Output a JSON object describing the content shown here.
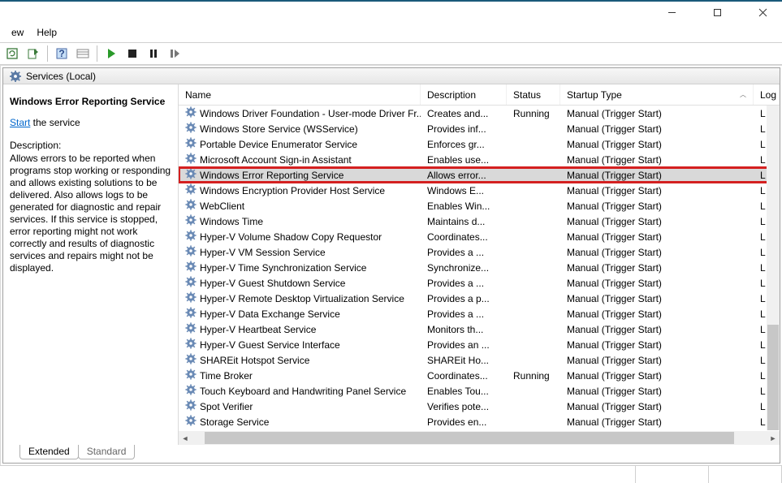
{
  "menus": {
    "view": "ew",
    "help": "Help"
  },
  "frameheader": {
    "title": "Services (Local)"
  },
  "details": {
    "serviceName": "Windows Error Reporting Service",
    "startLink": "Start",
    "startSuffix": " the service",
    "descLabel": "Description:",
    "description": "Allows errors to be reported when programs stop working or responding and allows existing solutions to be delivered. Also allows logs to be generated for diagnostic and repair services. If this service is stopped, error reporting might not work correctly and results of diagnostic services and repairs might not be displayed."
  },
  "columns": {
    "name": "Name",
    "description": "Description",
    "status": "Status",
    "startup": "Startup Type",
    "logon": "Log"
  },
  "services": [
    {
      "name": "Windows Driver Foundation - User-mode Driver Fr...",
      "desc": "Creates and...",
      "status": "Running",
      "startup": "Manual (Trigger Start)",
      "logon": "Loc"
    },
    {
      "name": "Windows Store Service (WSService)",
      "desc": "Provides inf...",
      "status": "",
      "startup": "Manual (Trigger Start)",
      "logon": "Loc"
    },
    {
      "name": "Portable Device Enumerator Service",
      "desc": "Enforces gr...",
      "status": "",
      "startup": "Manual (Trigger Start)",
      "logon": "Loc"
    },
    {
      "name": "Microsoft Account Sign-in Assistant",
      "desc": "Enables use...",
      "status": "",
      "startup": "Manual (Trigger Start)",
      "logon": "Loc"
    },
    {
      "name": "Windows Error Reporting Service",
      "desc": "Allows error...",
      "status": "",
      "startup": "Manual (Trigger Start)",
      "logon": "Loc",
      "highlight": true,
      "selected": true
    },
    {
      "name": "Windows Encryption Provider Host Service",
      "desc": "Windows E...",
      "status": "",
      "startup": "Manual (Trigger Start)",
      "logon": "Loc"
    },
    {
      "name": "WebClient",
      "desc": "Enables Win...",
      "status": "",
      "startup": "Manual (Trigger Start)",
      "logon": "Loc"
    },
    {
      "name": "Windows Time",
      "desc": "Maintains d...",
      "status": "",
      "startup": "Manual (Trigger Start)",
      "logon": "Loc"
    },
    {
      "name": "Hyper-V Volume Shadow Copy Requestor",
      "desc": "Coordinates...",
      "status": "",
      "startup": "Manual (Trigger Start)",
      "logon": "Loc"
    },
    {
      "name": "Hyper-V VM Session Service",
      "desc": "Provides a ...",
      "status": "",
      "startup": "Manual (Trigger Start)",
      "logon": "Loc"
    },
    {
      "name": "Hyper-V Time Synchronization Service",
      "desc": "Synchronize...",
      "status": "",
      "startup": "Manual (Trigger Start)",
      "logon": "Loc"
    },
    {
      "name": "Hyper-V Guest Shutdown Service",
      "desc": "Provides a ...",
      "status": "",
      "startup": "Manual (Trigger Start)",
      "logon": "Loc"
    },
    {
      "name": "Hyper-V Remote Desktop Virtualization Service",
      "desc": "Provides a p...",
      "status": "",
      "startup": "Manual (Trigger Start)",
      "logon": "Loc"
    },
    {
      "name": "Hyper-V Data Exchange Service",
      "desc": "Provides a ...",
      "status": "",
      "startup": "Manual (Trigger Start)",
      "logon": "Loc"
    },
    {
      "name": "Hyper-V Heartbeat Service",
      "desc": "Monitors th...",
      "status": "",
      "startup": "Manual (Trigger Start)",
      "logon": "Loc"
    },
    {
      "name": "Hyper-V Guest Service Interface",
      "desc": "Provides an ...",
      "status": "",
      "startup": "Manual (Trigger Start)",
      "logon": "Loc"
    },
    {
      "name": "SHAREit Hotspot Service",
      "desc": "SHAREit Ho...",
      "status": "",
      "startup": "Manual (Trigger Start)",
      "logon": "Loc"
    },
    {
      "name": "Time Broker",
      "desc": "Coordinates...",
      "status": "Running",
      "startup": "Manual (Trigger Start)",
      "logon": "Loc"
    },
    {
      "name": "Touch Keyboard and Handwriting Panel Service",
      "desc": "Enables Tou...",
      "status": "",
      "startup": "Manual (Trigger Start)",
      "logon": "Loc"
    },
    {
      "name": "Spot Verifier",
      "desc": "Verifies pote...",
      "status": "",
      "startup": "Manual (Trigger Start)",
      "logon": "Loc"
    },
    {
      "name": "Storage Service",
      "desc": "Provides en...",
      "status": "",
      "startup": "Manual (Trigger Start)",
      "logon": "Loc"
    }
  ],
  "tabs": {
    "extended": "Extended",
    "standard": "Standard"
  }
}
